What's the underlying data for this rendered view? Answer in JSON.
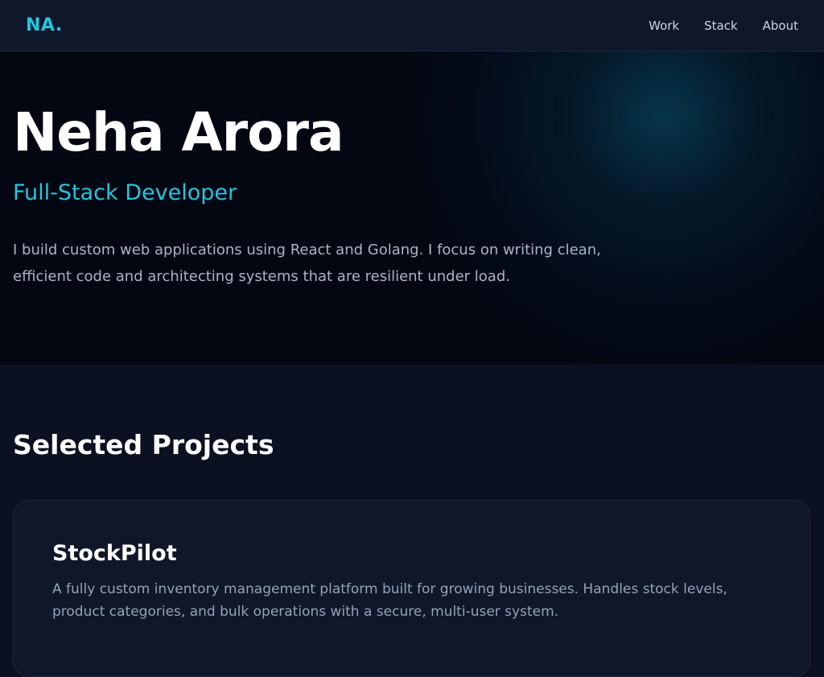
{
  "nav": {
    "logo": "NA.",
    "links": [
      "Work",
      "Stack",
      "About"
    ]
  },
  "hero": {
    "name": "Neha Arora",
    "role": "Full-Stack Developer",
    "bio": "I build custom web applications using React and Golang. I focus on writing clean, efficient code and architecting systems that are resilient under load."
  },
  "projects": {
    "title": "Selected Projects",
    "items": [
      {
        "name": "StockPilot",
        "description": "A fully custom inventory management platform built for growing businesses. Handles stock levels, product categories, and bulk operations with a secure, multi-user system."
      }
    ]
  },
  "colors": {
    "accent": "#22c6e0",
    "background": "#0b1120",
    "hero_background": "#030712",
    "card_background": "#0f1729"
  }
}
